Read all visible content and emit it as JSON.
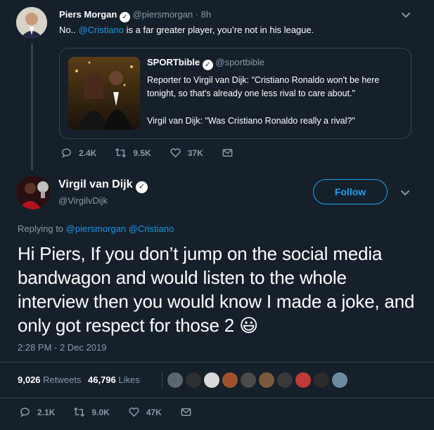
{
  "parent_tweet": {
    "name": "Piers Morgan",
    "handle": "@piersmorgan",
    "time": "· 8h",
    "text_prefix": "No.. ",
    "mention": "@Cristiano",
    "text_suffix": " is a far greater player, you’re not in his league.",
    "quote": {
      "name": "SPORTbible",
      "handle": "@sportbible",
      "line1": "Reporter to Virgil van Dijk: \"Cristiano Ronaldo won't be here tonight, so that's already one less rival to care about.\"",
      "line2": "Virgil van Dijk: \"Was Cristiano Ronaldo really a rival?\""
    },
    "actions": {
      "replies": "2.4K",
      "retweets": "9.5K",
      "likes": "37K"
    }
  },
  "main_tweet": {
    "name": "Virgil van Dijk",
    "handle": "@VirgilvDijk",
    "follow_label": "Follow",
    "replying_to_label": "Replying to",
    "replying_to_1": "@piersmorgan",
    "replying_to_2": "@Cristiano",
    "text": "Hi Piers, If you don’t jump on the social media bandwagon and would listen to the whole interview then you would know I made a joke, and only got respect for those 2",
    "emoji": "😃",
    "timestamp": "2:28 PM - 2 Dec 2019",
    "stats": {
      "retweets_count": "9,026",
      "retweets_label": "Retweets",
      "likes_count": "46,796",
      "likes_label": "Likes"
    },
    "actions": {
      "replies": "2.1K",
      "retweets": "9.0K",
      "likes": "47K"
    }
  },
  "colors": {
    "background": "#15202b",
    "link": "#1b95e0",
    "muted": "#8899a6",
    "border": "#38444d",
    "accent": "#1da1f2"
  }
}
